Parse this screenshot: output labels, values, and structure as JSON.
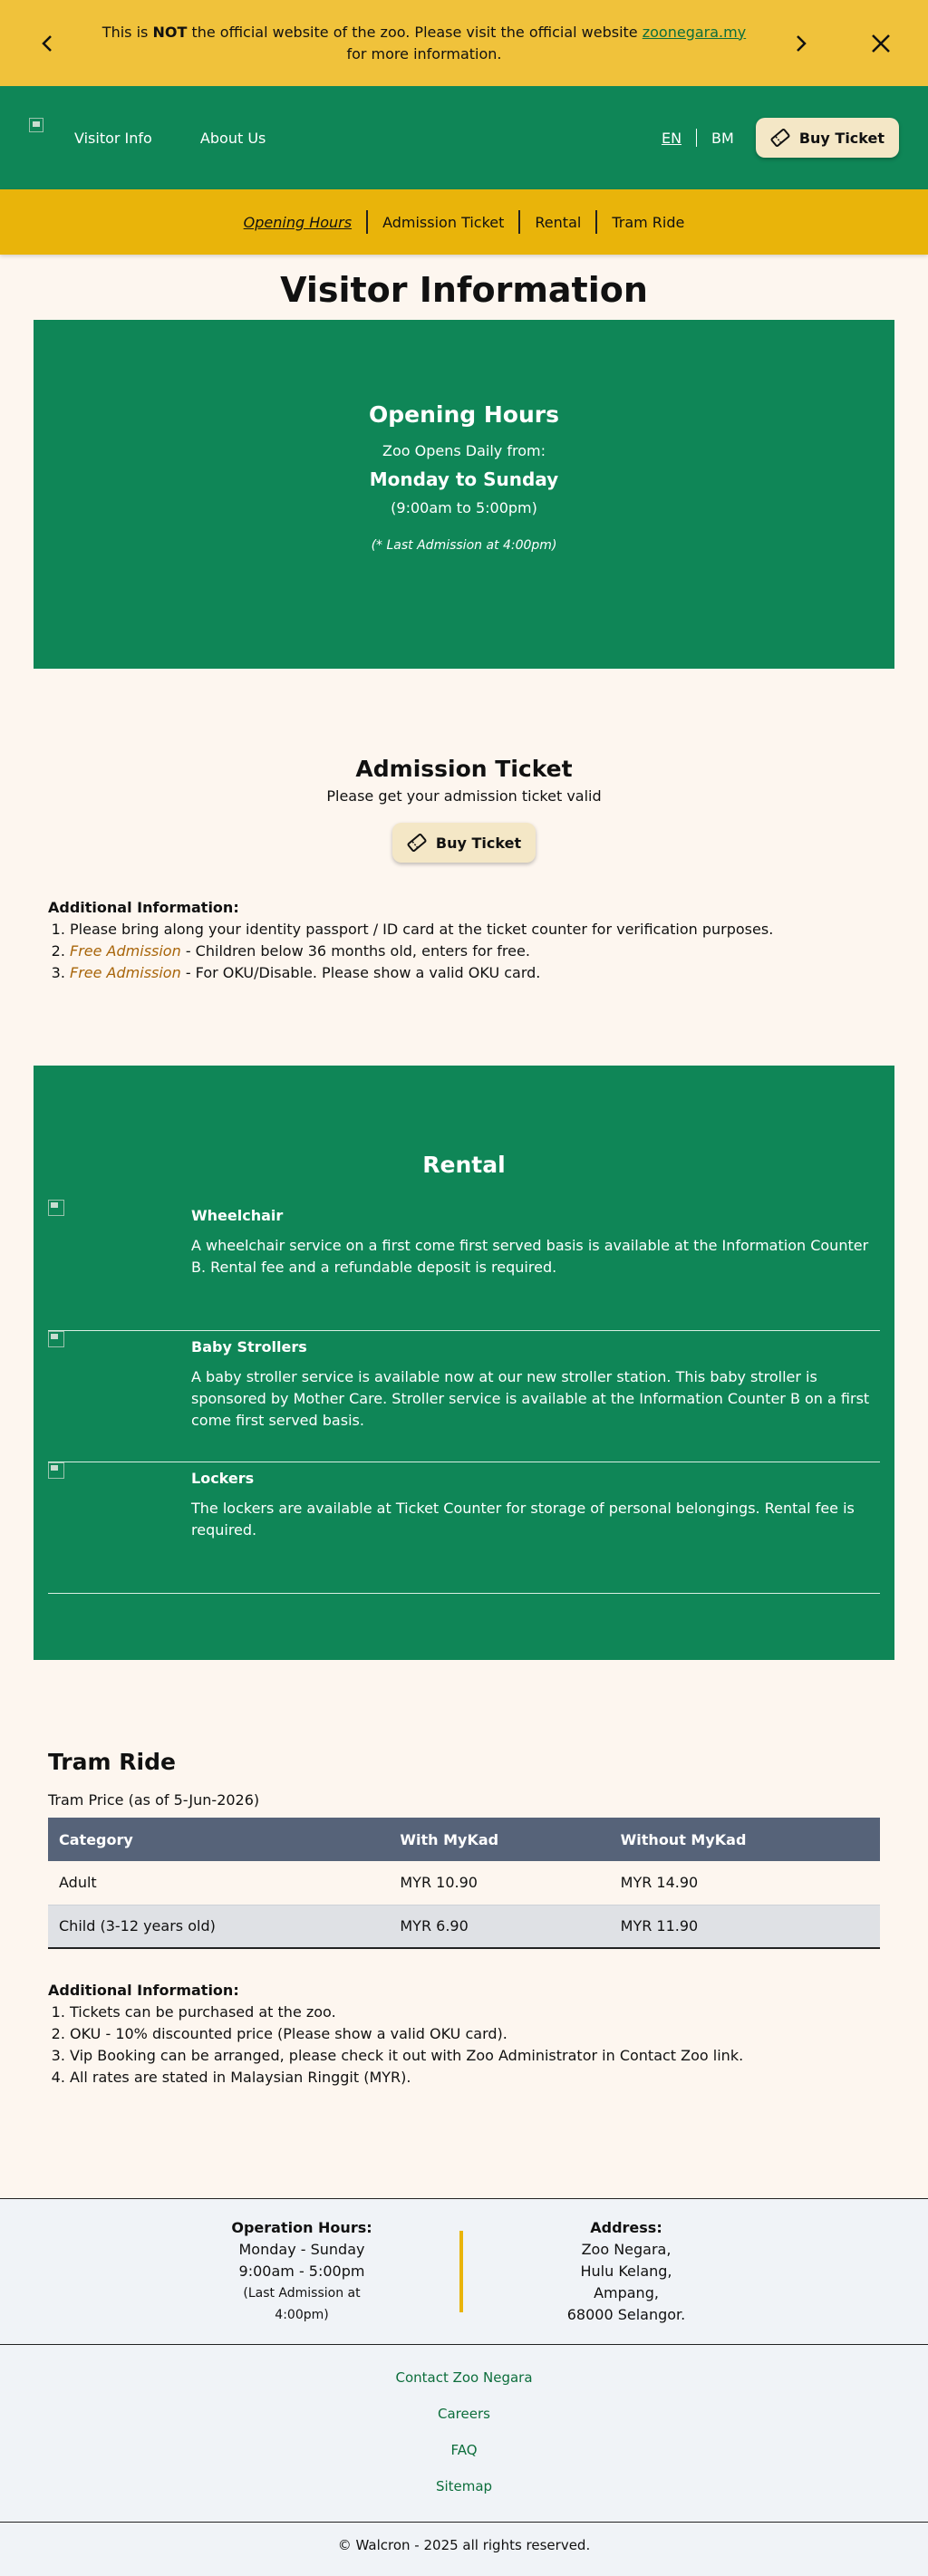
{
  "notice": {
    "prefix": "This is ",
    "strong": "NOT",
    "middle": " the official website of the zoo. Please visit the official website ",
    "link": "zoonegara.my",
    "suffix": " for more information."
  },
  "header": {
    "nav": [
      "Visitor Info",
      "About Us"
    ],
    "lang_en": "EN",
    "lang_bm": "BM",
    "buy_label": "Buy Ticket"
  },
  "subnav": [
    "Opening Hours",
    "Admission Ticket",
    "Rental",
    "Tram Ride"
  ],
  "page_title": "Visitor Information",
  "hours": {
    "title": "Opening Hours",
    "line1": "Zoo Opens Daily from:",
    "line2": "Monday to Sunday",
    "line3": "(9:00am to 5:00pm)",
    "line4": "(* Last Admission at 4:00pm)"
  },
  "admission": {
    "title": "Admission Ticket",
    "subtitle": "Please get your admission ticket valid",
    "buy_label": "Buy Ticket",
    "info_title": "Additional Information:",
    "items": [
      {
        "free": "",
        "text": "Please bring along your identity passport / ID card at the ticket counter for verification purposes."
      },
      {
        "free": "Free Admission",
        "text": " - Children below 36 months old, enters for free."
      },
      {
        "free": "Free Admission",
        "text": " - For OKU/Disable. Please show a valid OKU card."
      }
    ]
  },
  "rental": {
    "title": "Rental",
    "items": [
      {
        "name": "Wheelchair",
        "desc": "A wheelchair service on a first come first served basis is available at the Information Counter B. Rental fee and a refundable deposit is required."
      },
      {
        "name": "Baby Strollers",
        "desc": "A baby stroller service is available now at our new stroller station. This baby stroller is sponsored by Mother Care. Stroller service is available at the Information Counter B on a first come first served basis."
      },
      {
        "name": "Lockers",
        "desc": "The lockers are available at Ticket Counter for storage of personal belongings. Rental fee is required."
      }
    ]
  },
  "tram": {
    "title": "Tram Ride",
    "price_label": "Tram Price (as of 5-Jun-2026)",
    "columns": [
      "Category",
      "With MyKad",
      "Without MyKad"
    ],
    "rows": [
      [
        "Adult",
        "MYR 10.90",
        "MYR 14.90"
      ],
      [
        "Child (3-12 years old)",
        "MYR 6.90",
        "MYR 11.90"
      ]
    ],
    "info_title": "Additional Information:",
    "items": [
      "Tickets can be purchased at the zoo.",
      "OKU - 10% discounted price (Please show a valid OKU card).",
      "Vip Booking can be arranged, please check it out with Zoo Administrator in Contact Zoo link.",
      "All rates are stated in Malaysian Ringgit (MYR)."
    ]
  },
  "footer": {
    "hours_title": "Operation Hours:",
    "hours_days": "Monday - Sunday",
    "hours_time": "9:00am - 5:00pm",
    "hours_last": "(Last Admission at 4:00pm)",
    "address_title": "Address:",
    "address_lines": [
      "Zoo Negara,",
      "Hulu Kelang,",
      "Ampang,",
      "68000 Selangor."
    ],
    "links": [
      "Contact Zoo Negara",
      "Careers",
      "FAQ",
      "Sitemap"
    ],
    "copyright": "© Walcron - 2025 all rights reserved."
  }
}
